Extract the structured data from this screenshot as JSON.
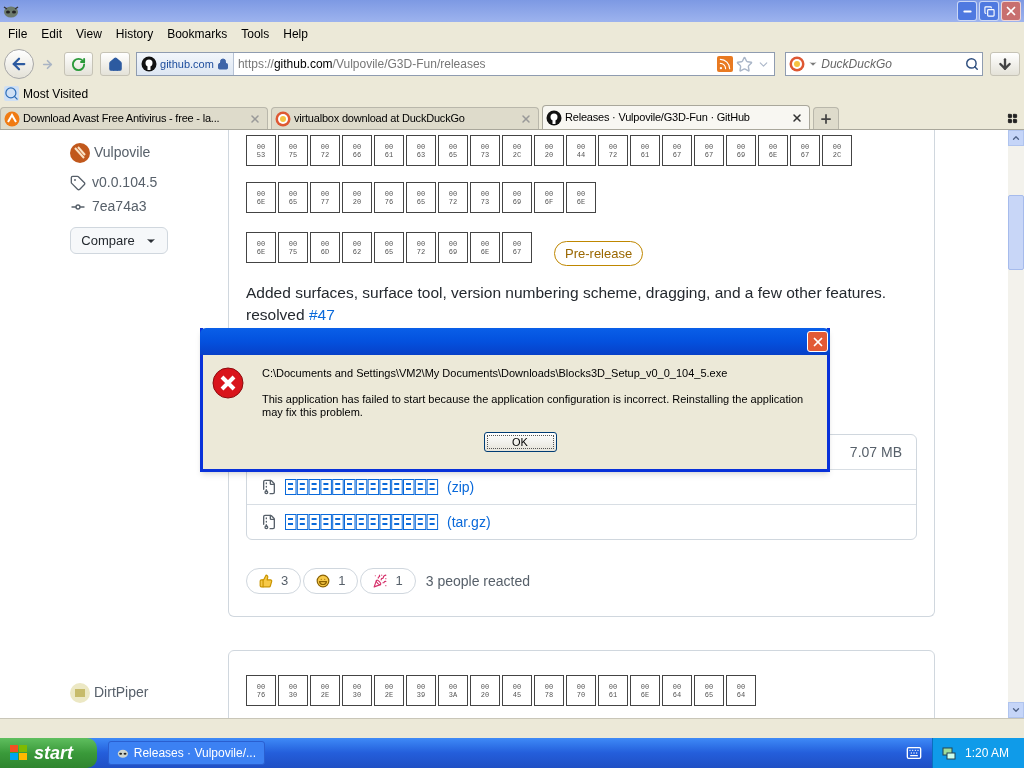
{
  "menu": [
    "File",
    "Edit",
    "View",
    "History",
    "Bookmarks",
    "Tools",
    "Help"
  ],
  "nav": {
    "identity": "github.com",
    "url": {
      "scheme": "https://",
      "host": "github.com",
      "path": "/Vulpovile/G3D-Fun/releases"
    },
    "search_placeholder": "DuckDuckGo"
  },
  "bookmarks": [
    "Most Visited"
  ],
  "tabs": [
    {
      "label": "Download Avast Free Antivirus - free - la...",
      "selected": false
    },
    {
      "label": "virtualbox download at DuckDuckGo",
      "selected": false
    },
    {
      "label": "Releases · Vulpovile/G3D-Fun · GitHub",
      "selected": true
    }
  ],
  "releases": [
    {
      "author": "Vulpovile",
      "tag": "v0.0.104.5",
      "commit": "7ea74a3",
      "compare": "Compare",
      "badge": "Pre-release",
      "title_rows": [
        [
          "0053",
          "0075",
          "0072",
          "0066",
          "0061",
          "0063",
          "0065",
          "0073",
          "002C",
          "0020",
          "0044",
          "0072",
          "0061",
          "0067",
          "0067",
          "0069",
          "006E",
          "0067",
          "002C"
        ],
        [
          "006E",
          "0065",
          "0077",
          "0020",
          "0076",
          "0065",
          "0072",
          "0073",
          "0069",
          "006F",
          "006E"
        ],
        [
          "006E",
          "0075",
          "006D",
          "0062",
          "0065",
          "0072",
          "0069",
          "006E",
          "0067"
        ]
      ],
      "body": "Added surfaces, surface tool, version numbering scheme, dragging, and a few other features.",
      "resolved": {
        "text": "resolved",
        "link": "#47"
      },
      "assets": [
        {
          "kind": "binary",
          "size": "7.07 MB"
        },
        {
          "kind": "source",
          "label": "(zip)"
        },
        {
          "kind": "source",
          "label": "(tar.gz)"
        }
      ],
      "reactions": [
        {
          "kind": "thumbs",
          "count": "3"
        },
        {
          "kind": "laugh",
          "count": "1"
        },
        {
          "kind": "hooray",
          "count": "1"
        }
      ],
      "reacted": "3 people reacted"
    },
    {
      "author": "DirtPiper",
      "title_rows": [
        [
          "0076",
          "0030",
          "002E",
          "0030",
          "002E",
          "0039",
          "003A",
          "0020",
          "0045",
          "0078",
          "0070",
          "0061",
          "006E",
          "0064",
          "0065",
          "0064"
        ]
      ]
    }
  ],
  "dialog": {
    "path": "C:\\Documents and Settings\\VM2\\My Documents\\Downloads\\Blocks3D_Setup_v0_0_104_5.exe",
    "message": "This application has failed to start because the application configuration is incorrect. Reinstalling the application may fix this problem.",
    "button": "OK"
  },
  "taskbar": {
    "start": "start",
    "tasks": [
      "Releases · Vulpovile/..."
    ],
    "clock": "1:20 AM"
  }
}
